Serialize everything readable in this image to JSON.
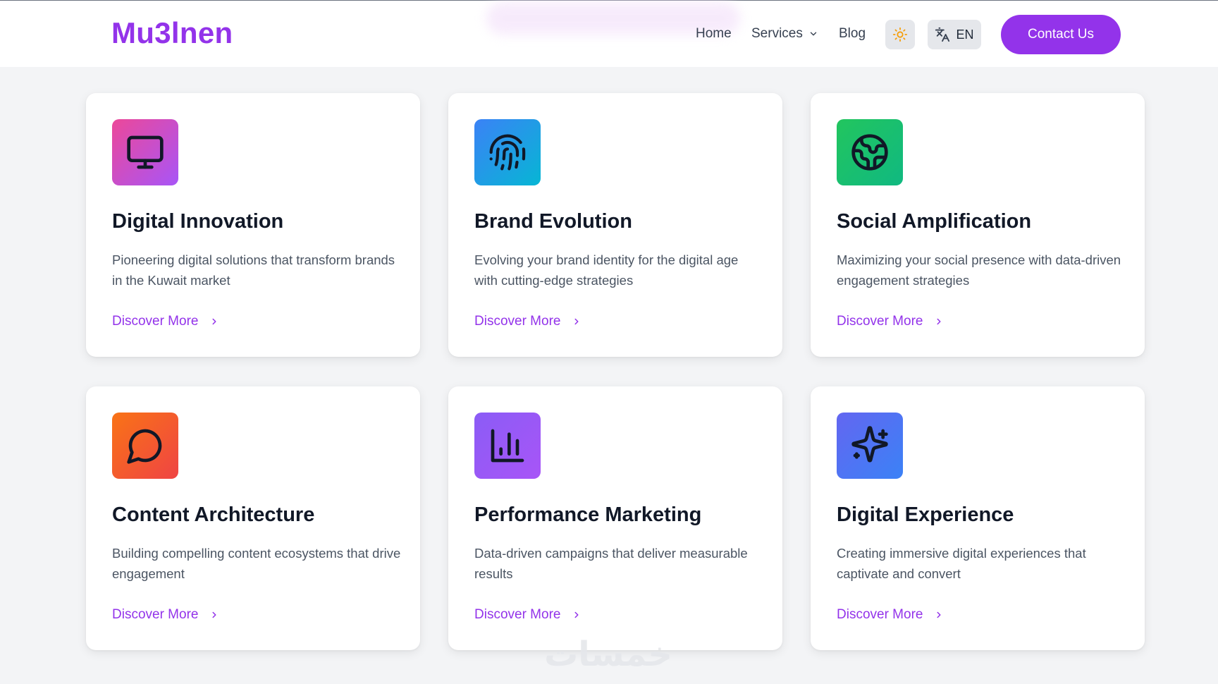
{
  "header": {
    "logo": "Mu3lnen",
    "nav": {
      "home": "Home",
      "services": "Services",
      "blog": "Blog"
    },
    "language": "EN",
    "contact_label": "Contact Us"
  },
  "cards": [
    {
      "title": "Digital Innovation",
      "description": "Pioneering digital solutions that transform brands in the Kuwait market",
      "link": "Discover More",
      "icon": "monitor-icon",
      "gradient": [
        "#ec4899",
        "#a855f7"
      ]
    },
    {
      "title": "Brand Evolution",
      "description": "Evolving your brand identity for the digital age with cutting-edge strategies",
      "link": "Discover More",
      "icon": "fingerprint-icon",
      "gradient": [
        "#3b82f6",
        "#06b6d4"
      ]
    },
    {
      "title": "Social Amplification",
      "description": "Maximizing your social presence with data-driven engagement strategies",
      "link": "Discover More",
      "icon": "globe-icon",
      "gradient": [
        "#22c55e",
        "#10b981"
      ]
    },
    {
      "title": "Content Architecture",
      "description": "Building compelling content ecosystems that drive engagement",
      "link": "Discover More",
      "icon": "message-circle-icon",
      "gradient": [
        "#f97316",
        "#ef4444"
      ]
    },
    {
      "title": "Performance Marketing",
      "description": "Data-driven campaigns that deliver measurable results",
      "link": "Discover More",
      "icon": "bar-chart-icon",
      "gradient": [
        "#8b5cf6",
        "#a855f7"
      ]
    },
    {
      "title": "Digital Experience",
      "description": "Creating immersive digital experiences that captivate and convert",
      "link": "Discover More",
      "icon": "sparkles-icon",
      "gradient": [
        "#6366f1",
        "#3b82f6"
      ]
    }
  ],
  "watermark": "خمسات",
  "colors": {
    "accent": "#9333ea",
    "background": "#f3f4f6"
  }
}
